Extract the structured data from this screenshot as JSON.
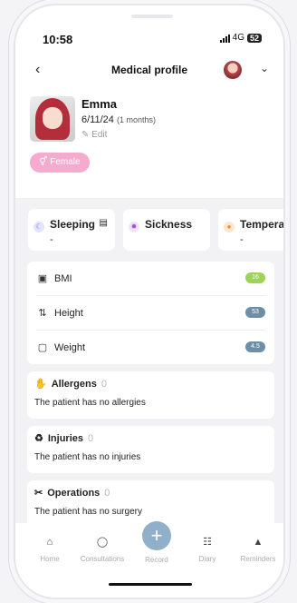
{
  "status": {
    "time": "10:58",
    "network": "4G",
    "battery": "52"
  },
  "header": {
    "title": "Medical profile"
  },
  "profile": {
    "name": "Emma",
    "dob": "6/11/24",
    "age": "(1 months)",
    "edit_label": "Edit",
    "gender": "Female"
  },
  "cards": [
    {
      "title": "Sleeping",
      "value": "-"
    },
    {
      "title": "Sickness",
      "value": ""
    },
    {
      "title": "Temperat",
      "value": "-"
    }
  ],
  "metrics": [
    {
      "label": "BMI",
      "badge": "16"
    },
    {
      "label": "Height",
      "badge": "53"
    },
    {
      "label": "Weight",
      "badge": "4.5"
    }
  ],
  "sections": [
    {
      "title": "Allergens",
      "count": "0",
      "text": "The patient has no allergies"
    },
    {
      "title": "Injuries",
      "count": "0",
      "text": "The patient has no injuries"
    },
    {
      "title": "Operations",
      "count": "0",
      "text": "The patient has no surgery"
    }
  ],
  "tabs": [
    {
      "label": "Home"
    },
    {
      "label": "Consultations"
    },
    {
      "label": "Record"
    },
    {
      "label": "Diary"
    },
    {
      "label": "Reminders"
    }
  ],
  "colors": {
    "bmi_badge": "#9ed35a",
    "height_badge": "#6e8ea8",
    "weight_badge": "#6e8ea8",
    "record_button": "#8fb0c8",
    "gender_pill": "#f4a3c8"
  },
  "icons": {
    "back": "chevron-left-icon",
    "dropdown": "chevron-down-icon",
    "sleeping": "moon-icon",
    "sickness": "virus-icon",
    "temperature": "thermometer-icon",
    "bmi": "scale-icon",
    "height": "ruler-icon",
    "weight": "weight-icon"
  }
}
